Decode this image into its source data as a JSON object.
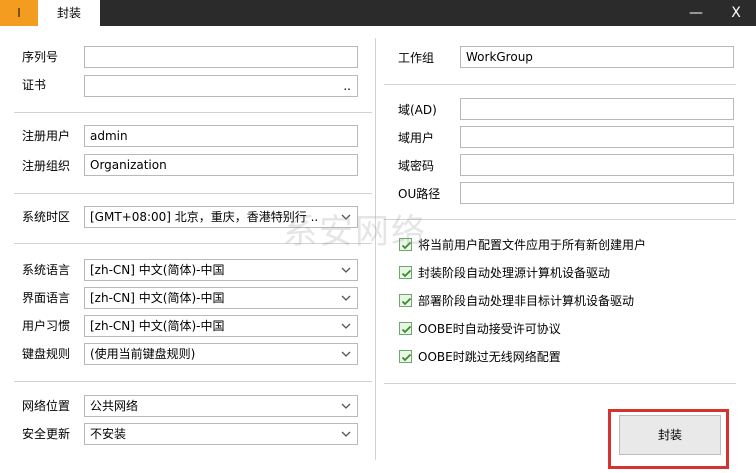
{
  "titlebar": {
    "app_icon_text": "I",
    "tab_label": "封装",
    "minimize": "—",
    "close": "X"
  },
  "left": {
    "serial_label": "序列号",
    "serial_value": "",
    "cert_label": "证书",
    "cert_value": "",
    "cert_browse": "..",
    "reg_user_label": "注册用户",
    "reg_user_value": "admin",
    "reg_org_label": "注册组织",
    "reg_org_value": "Organization",
    "timezone_label": "系统时区",
    "timezone_value": "[GMT+08:00] 北京，重庆，香港特别行 ..",
    "sys_lang_label": "系统语言",
    "sys_lang_value": "[zh-CN] 中文(简体)-中国",
    "ui_lang_label": "界面语言",
    "ui_lang_value": "[zh-CN] 中文(简体)-中国",
    "user_locale_label": "用户习惯",
    "user_locale_value": "[zh-CN] 中文(简体)-中国",
    "keyboard_label": "键盘规则",
    "keyboard_value": "(使用当前键盘规则)",
    "net_loc_label": "网络位置",
    "net_loc_value": "公共网络",
    "sec_update_label": "安全更新",
    "sec_update_value": "不安装"
  },
  "right": {
    "workgroup_label": "工作组",
    "workgroup_value": "WorkGroup",
    "domain_label": "域(AD)",
    "domain_value": "",
    "domain_user_label": "域用户",
    "domain_user_value": "",
    "domain_pass_label": "域密码",
    "domain_pass_value": "",
    "ou_label": "OU路径",
    "ou_value": "",
    "options": [
      "将当前用户配置文件应用于所有新创建用户",
      "封装阶段自动处理源计算机设备驱动",
      "部署阶段自动处理非目标计算机设备驱动",
      "OOBE时自动接受许可协议",
      "OOBE时跳过无线网络配置"
    ],
    "seal_button": "封装"
  },
  "watermark": "系安网络",
  "colors": {
    "titlebar": "#2b2b2b",
    "app_icon": "#f39c1f",
    "check": "#4a9a3e",
    "highlight": "#d6332e"
  }
}
